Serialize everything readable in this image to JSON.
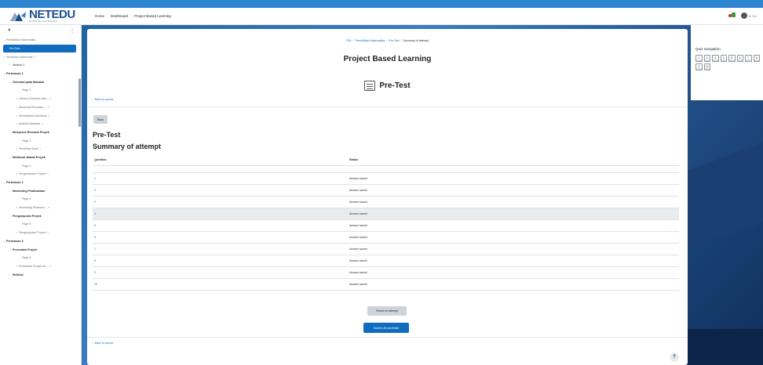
{
  "header": {
    "brand": "NETEDU",
    "tagline": "HYBRID LEARNING",
    "nav": [
      "Home",
      "Dashboard",
      "Project Based Learning"
    ],
    "user_initials": "NA"
  },
  "drawer": {
    "items": [
      {
        "label": "Pendidikan Matematika",
        "chev": "⌄",
        "indent": 4,
        "style": "muted"
      },
      {
        "label": "Pre-Test",
        "chev": "",
        "indent": 6,
        "style": "active"
      },
      {
        "label": "Pemikiran Matematis",
        "chev": "○",
        "indent": 4,
        "style": "muted",
        "lock": true
      },
      {
        "label": "Section 1",
        "chev": "›",
        "indent": 12,
        "style": ""
      },
      {
        "label": "Pertemuan 1",
        "chev": "⌄",
        "indent": 4,
        "style": "bold"
      },
      {
        "label": "Orientasi pada Masalah",
        "chev": "⌄",
        "indent": 12,
        "style": "bold"
      },
      {
        "label": "Page 1",
        "chev": "",
        "indent": 24,
        "style": "muted"
      },
      {
        "label": "Diskusi Orientasi Mas...",
        "chev": "○",
        "indent": 20,
        "style": "muted",
        "lock": true
      },
      {
        "label": "Membuat Rumusan ...",
        "chev": "○",
        "indent": 20,
        "style": "muted",
        "lock": true
      },
      {
        "label": "Menetapkan Hipotesis",
        "chev": "○",
        "indent": 20,
        "style": "muted",
        "lock": true
      },
      {
        "label": "Analisis Masalah",
        "chev": "○",
        "indent": 20,
        "style": "muted",
        "lock": true
      },
      {
        "label": "Menyusun Rencana Proyek",
        "chev": "⌄",
        "indent": 12,
        "style": "bold"
      },
      {
        "label": "Page 2",
        "chev": "",
        "indent": 24,
        "style": "muted"
      },
      {
        "label": "Penelitian Awal",
        "chev": "○",
        "indent": 20,
        "style": "muted",
        "lock": true
      },
      {
        "label": "Membuat Jadwal Proyek",
        "chev": "⌄",
        "indent": 12,
        "style": "bold"
      },
      {
        "label": "Page 3",
        "chev": "",
        "indent": 24,
        "style": "muted"
      },
      {
        "label": "Pengumpulan Proyek",
        "chev": "○",
        "indent": 20,
        "style": "muted",
        "lock": true
      },
      {
        "label": "Pertemuan 2",
        "chev": "⌄",
        "indent": 4,
        "style": "bold"
      },
      {
        "label": "Monitoring Pelaksanaan",
        "chev": "⌄",
        "indent": 12,
        "style": "bold"
      },
      {
        "label": "Page 4",
        "chev": "",
        "indent": 24,
        "style": "muted"
      },
      {
        "label": "Monitoring Pelaksan...",
        "chev": "○",
        "indent": 20,
        "style": "muted",
        "lock": true
      },
      {
        "label": "Pengumpulan Proyek",
        "chev": "⌄",
        "indent": 12,
        "style": "bold"
      },
      {
        "label": "Page 5",
        "chev": "",
        "indent": 24,
        "style": "muted"
      },
      {
        "label": "Pengumpulan Proyek",
        "chev": "○",
        "indent": 20,
        "style": "muted",
        "lock": true
      },
      {
        "label": "Pertemuan 3",
        "chev": "⌄",
        "indent": 4,
        "style": "bold"
      },
      {
        "label": "Presentasi Proyek",
        "chev": "⌄",
        "indent": 12,
        "style": "bold"
      },
      {
        "label": "Page 6",
        "chev": "",
        "indent": 24,
        "style": "muted"
      },
      {
        "label": "Presentasi Proyek Ke...",
        "chev": "○",
        "indent": 20,
        "style": "muted",
        "lock": true
      },
      {
        "label": "Refleksi",
        "chev": "›",
        "indent": 12,
        "style": "bold"
      }
    ]
  },
  "main": {
    "breadcrumb": [
      "PBL",
      "Pendidikan Matematika",
      "Pre-Test",
      "Summary of attempt"
    ],
    "course_title": "Project Based Learning",
    "activity_title": "Pre-Test",
    "back_to_course": "Back to course",
    "back_button": "Back",
    "heading": "Pre-Test",
    "subheading": "Summary of attempt",
    "table": {
      "headers": [
        "Question",
        "Status"
      ],
      "rows": [
        {
          "q": "1",
          "status": "Answer saved"
        },
        {
          "q": "2",
          "status": "Answer saved"
        },
        {
          "q": "3",
          "status": "Answer saved"
        },
        {
          "q": "4",
          "status": "Answer saved"
        },
        {
          "q": "5",
          "status": "Answer saved"
        },
        {
          "q": "6",
          "status": "Answer saved"
        },
        {
          "q": "7",
          "status": "Answer saved"
        },
        {
          "q": "8",
          "status": "Answer saved"
        },
        {
          "q": "9",
          "status": "Answer saved"
        },
        {
          "q": "10",
          "status": "Answer saved"
        }
      ],
      "highlighted_row": 3
    },
    "return_button": "Return to attempt",
    "submit_button": "Submit all and finish",
    "help": "?"
  },
  "quiz_nav": {
    "title": "Quiz navigation",
    "buttons": [
      "1",
      "2",
      "3",
      "4",
      "5",
      "6",
      "7",
      "8",
      "9",
      "10"
    ]
  },
  "colors": {
    "primary": "#0f6cbf",
    "brand": "#1a4f8f",
    "secondary_button": "#ced4da",
    "highlight_row": "#e9ecef"
  }
}
